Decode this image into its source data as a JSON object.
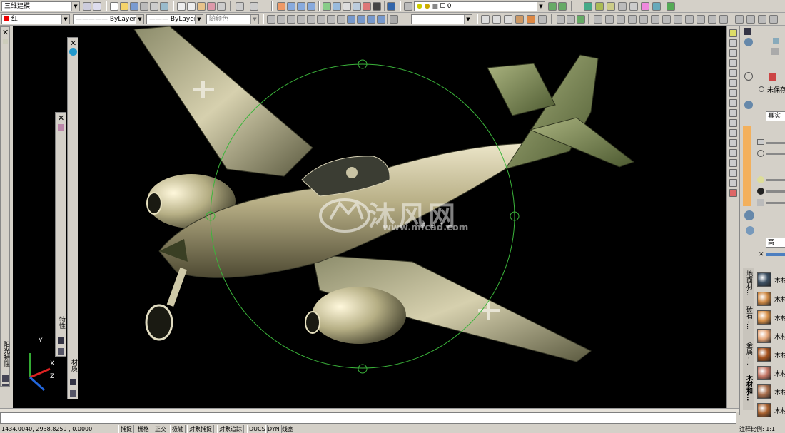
{
  "toolbar1": {
    "workspace": "三维建模",
    "layer": "0"
  },
  "toolbar2": {
    "color": "红",
    "linetype": "ByLayer",
    "lineweight": "ByLayer",
    "plotstyle": "随颜色"
  },
  "left_palettes": {
    "sun_properties": "阳光特性",
    "properties": "特性",
    "materials": "材质"
  },
  "ucs_icon": {
    "x": "X",
    "y": "Y",
    "z": "Z"
  },
  "right_panel": {
    "unsaved_label": "未保存",
    "visual_style": "真实",
    "quality": "高",
    "tabs": [
      "地面材...",
      "砖石 -...",
      "金属 -...",
      "木材和..."
    ],
    "materials": [
      "木材",
      "木材",
      "木材",
      "木材",
      "木材",
      "木材",
      "木材",
      "木材"
    ],
    "material_colors": [
      "#3c4f62",
      "#d08a45",
      "#d9934c",
      "#e6a77a",
      "#a6531e",
      "#c47766",
      "#a86e4c",
      "#a9612e"
    ]
  },
  "watermark": {
    "brand": "沐风网",
    "url": "www.mfcad.com"
  },
  "status_bar": {
    "coords": "1434.0040, 2938.8259 , 0.0000",
    "toggles": [
      "捕捉",
      "栅格",
      "正交",
      "极轴",
      "对象捕捉",
      "对象追踪",
      "DUCS",
      "DYN",
      "线宽"
    ],
    "annotation_scale": "注释比例: 1:1"
  },
  "colors": {
    "viewport_bg": "#000000",
    "accent_orange": "#f3b05c",
    "orbit_green": "#3bb53b",
    "ui_gray": "#d4d0c8"
  }
}
